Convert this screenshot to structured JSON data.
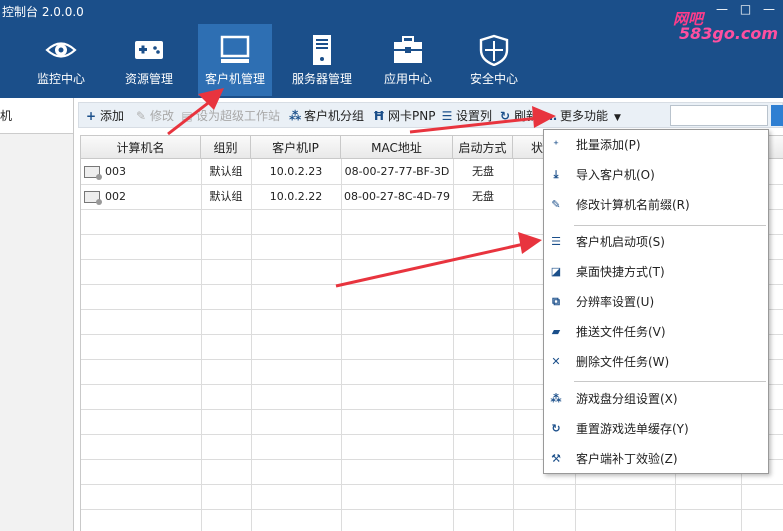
{
  "app": {
    "title": "控制台 2.0.0.0",
    "window_controls": "— □ —"
  },
  "watermark": {
    "line1": "网吧",
    "line2": "583go.com"
  },
  "nav": [
    {
      "label": "监控中心",
      "icon": "eye-icon"
    },
    {
      "label": "资源管理",
      "icon": "gamepad-icon"
    },
    {
      "label": "客户机管理",
      "icon": "monitor-icon",
      "active": true
    },
    {
      "label": "服务器管理",
      "icon": "server-icon"
    },
    {
      "label": "应用中心",
      "icon": "toolbox-icon"
    },
    {
      "label": "安全中心",
      "icon": "shield-icon"
    }
  ],
  "left_panel": {
    "item": "机"
  },
  "toolbar": {
    "add": "添加",
    "edit": "修改",
    "super_ws": "设为超级工作站",
    "client_group": "客户机分组",
    "nic_pnp": "网卡PNP",
    "set_columns": "设置列",
    "refresh": "刷新",
    "more": "更多功能"
  },
  "table": {
    "columns": [
      "计算机名",
      "组别",
      "客户机IP",
      "MAC地址",
      "启动方式",
      "状"
    ],
    "rows": [
      {
        "name": "003",
        "group": "默认组",
        "ip": "10.0.2.23",
        "mac": "08-00-27-77-BF-3D",
        "boot": "无盘"
      },
      {
        "name": "002",
        "group": "默认组",
        "ip": "10.0.2.22",
        "mac": "08-00-27-8C-4D-79",
        "boot": "无盘"
      }
    ]
  },
  "menu": {
    "items": [
      {
        "label": "批量添加(P)",
        "icon": "batch-add-icon"
      },
      {
        "label": "导入客户机(O)",
        "icon": "import-icon"
      },
      {
        "label": "修改计算机名前缀(R)",
        "icon": "pen-icon"
      },
      {
        "label": "客户机启动项(S)",
        "icon": "list-icon"
      },
      {
        "label": "桌面快捷方式(T)",
        "icon": "shortcut-icon"
      },
      {
        "label": "分辨率设置(U)",
        "icon": "resolution-icon"
      },
      {
        "label": "推送文件任务(V)",
        "icon": "folder-icon"
      },
      {
        "label": "删除文件任务(W)",
        "icon": "delete-icon"
      },
      {
        "label": "游戏盘分组设置(X)",
        "icon": "group-icon"
      },
      {
        "label": "重置游戏选单缓存(Y)",
        "icon": "reset-icon"
      },
      {
        "label": "客户端补丁效验(Z)",
        "icon": "wrench-icon"
      }
    ]
  },
  "colors": {
    "header_bg": "#1b4f8a",
    "active_tab": "#2e6fb3",
    "arrow": "#e8343e"
  }
}
